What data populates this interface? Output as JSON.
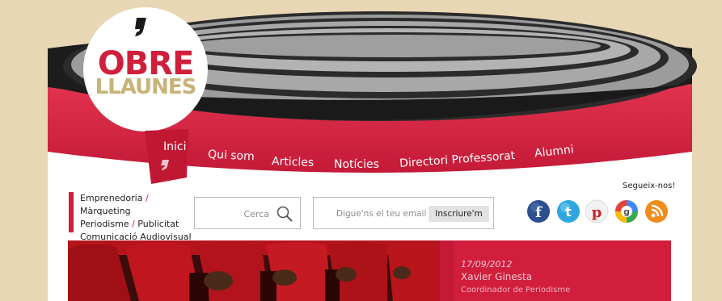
{
  "logo": {
    "line1": "OBRE",
    "line2": "LLAUNES"
  },
  "nav": {
    "items": [
      "Inici",
      "Qui som",
      "Articles",
      "Notícies",
      "Directori Professorat",
      "Alumni"
    ],
    "active": "Inici"
  },
  "categories": {
    "line1": [
      "Emprenedoria",
      "Màrqueting"
    ],
    "line2": [
      "Periodisme",
      "Publicitat"
    ],
    "line3": "Comunicació Audiovisual",
    "separator": "/"
  },
  "search": {
    "placeholder": "Cerca"
  },
  "newsletter": {
    "placeholder": "Digue'ns el teu email",
    "button": "Inscriure'm"
  },
  "social": {
    "label": "Segueix-nos!",
    "icons": [
      "facebook-icon",
      "twitter-icon",
      "pinterest-icon",
      "google-icon",
      "rss-icon"
    ]
  },
  "featured": {
    "date": "17/09/2012",
    "author": "Xavier Ginesta",
    "role": "Coordinador de Periodisme"
  },
  "colors": {
    "brand_red": "#d01e3c",
    "background": "#e8d7b4",
    "logo_gold": "#c7b278"
  }
}
